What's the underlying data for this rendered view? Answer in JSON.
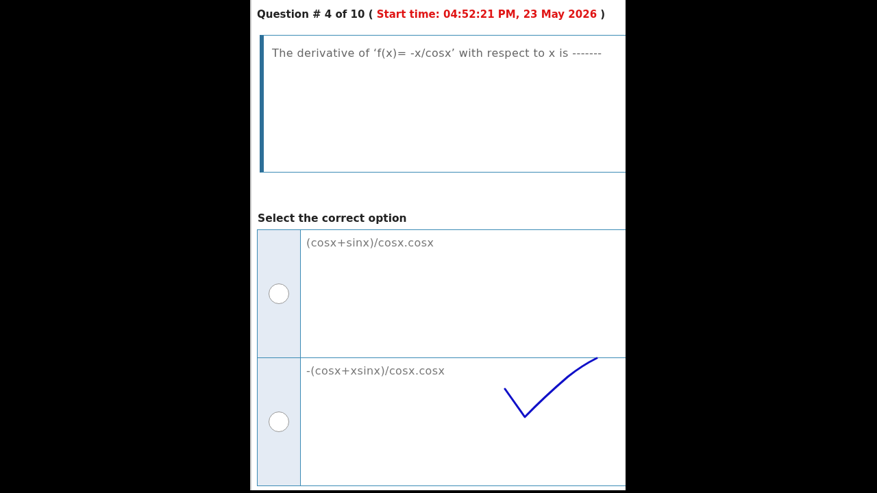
{
  "header": {
    "counter": "Question # 4 of 10 (",
    "start_time": "Start time: 04:52:21 PM, 23 May 2026",
    "suffix": ")"
  },
  "question": {
    "text": "The derivative of ‘f(x)= -x/cosx’ with respect to x is -------"
  },
  "options_heading": "Select the correct option",
  "options": [
    {
      "text": "(cosx+sinx)/cosx.cosx",
      "selected": false,
      "ticked": false
    },
    {
      "text": "-(cosx+xsinx)/cosx.cosx",
      "selected": false,
      "ticked": true
    }
  ]
}
